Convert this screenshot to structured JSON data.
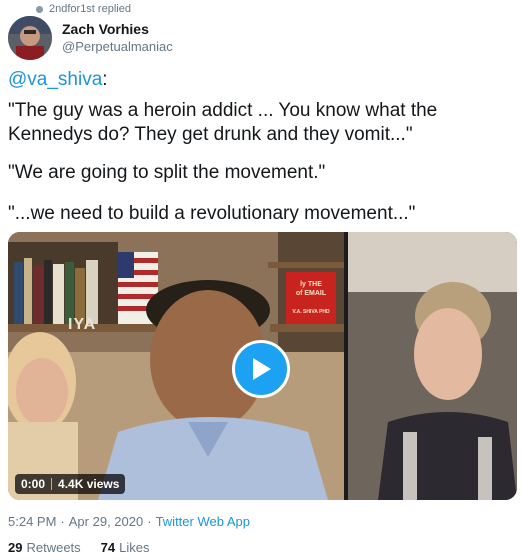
{
  "reply_context": {
    "text": "2ndfor1st replied"
  },
  "author": {
    "display_name": "Zach Vorhies",
    "handle": "@Perpetualmaniac"
  },
  "tweet": {
    "mention": "@va_shiva",
    "mention_suffix": ":",
    "paragraphs": [
      "\"The guy was a heroin addict ... You know what the Kennedys do? They get drunk and they vomit...\"",
      "\"We are going to split the movement.\"",
      "\"...we need to build a revolutionary movement...\""
    ]
  },
  "video": {
    "time": "0:00",
    "views": "4.4K views",
    "book_title_line1": "ly THE",
    "book_title_line2": "of EMAIL",
    "book_author": "V.A. SHIVA PHD",
    "shelf_text": "IYA",
    "play_icon": "play-icon"
  },
  "meta": {
    "time": "5:24 PM",
    "separator1": "·",
    "date": "Apr 29, 2020",
    "separator2": "·",
    "source": "Twitter Web App"
  },
  "stats": {
    "retweets_count": "29",
    "retweets_label": "Retweets",
    "likes_count": "74",
    "likes_label": "Likes"
  },
  "colors": {
    "link": "#1b95e0",
    "play_button": "#1da1f2",
    "secondary_text": "#657786"
  }
}
